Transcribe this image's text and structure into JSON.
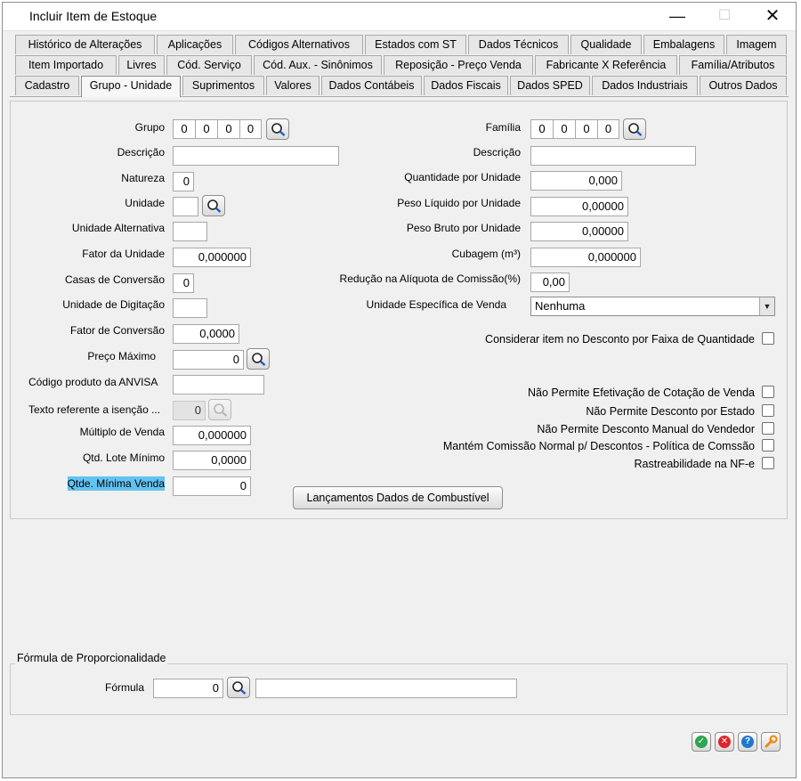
{
  "window": {
    "title": "Incluir Item de Estoque",
    "min_icon": "minimize-icon",
    "max_icon": "maximize-icon",
    "close_icon": "close-icon"
  },
  "tabs": {
    "row1": [
      "Histórico de Alterações",
      "Aplicações",
      "Códigos Alternativos",
      "Estados com ST",
      "Dados Técnicos",
      "Qualidade",
      "Embalagens",
      "Imagem"
    ],
    "row2": [
      "Item Importado",
      "Livres",
      "Cód. Serviço",
      "Cód. Aux. - Sinônimos",
      "Reposição - Preço Venda",
      "Fabricante X Referência",
      "Família/Atributos"
    ],
    "row3": [
      "Cadastro",
      "Grupo - Unidade",
      "Suprimentos",
      "Valores",
      "Dados Contábeis",
      "Dados Fiscais",
      "Dados SPED",
      "Dados Industriais",
      "Outros Dados"
    ],
    "active": "Grupo - Unidade"
  },
  "left": {
    "grupo": {
      "label": "Grupo",
      "segments": [
        "0",
        "0",
        "0",
        "0"
      ]
    },
    "descricao": {
      "label": "Descrição",
      "value": ""
    },
    "natureza": {
      "label": "Natureza",
      "value": "0"
    },
    "unidade": {
      "label": "Unidade",
      "value": ""
    },
    "unidade_alternativa": {
      "label": "Unidade Alternativa",
      "value": ""
    },
    "fator_unidade": {
      "label": "Fator da Unidade",
      "value": "0,000000"
    },
    "casas_conversao": {
      "label": "Casas de Conversão",
      "value": "0"
    },
    "unidade_digitacao": {
      "label": "Unidade de Digitação",
      "value": ""
    },
    "fator_conversao": {
      "label": "Fator de Conversão",
      "value": "0,0000"
    },
    "preco_maximo": {
      "label": "Preço Máximo",
      "value": "0"
    },
    "codigo_anvisa": {
      "label": "Código produto da ANVISA",
      "value": ""
    },
    "texto_isencao": {
      "label": "Texto referente a isenção ...",
      "value": "0"
    },
    "multiplo_venda": {
      "label": "Múltiplo de Venda",
      "value": "0,000000"
    },
    "qtd_lote_minimo": {
      "label": "Qtd. Lote Mínimo",
      "value": "0,0000"
    },
    "qtde_minima_venda": {
      "label": "Qtde. Mínima Venda",
      "value": "0"
    }
  },
  "right": {
    "familia": {
      "label": "Família",
      "segments": [
        "0",
        "0",
        "0",
        "0"
      ]
    },
    "descricao": {
      "label": "Descrição",
      "value": ""
    },
    "quantidade_unidade": {
      "label": "Quantidade por Unidade",
      "value": "0,000"
    },
    "peso_liquido": {
      "label": "Peso Líquido por Unidade",
      "value": "0,00000"
    },
    "peso_bruto": {
      "label": "Peso Bruto por Unidade",
      "value": "0,00000"
    },
    "cubagem": {
      "label": "Cubagem (m³)",
      "value": "0,000000"
    },
    "reducao_comissao": {
      "label": "Redução na Alíquota de Comissão(%)",
      "value": "0,00"
    },
    "unidade_especifica": {
      "label": "Unidade Específica de Venda",
      "value": "Nenhuma"
    },
    "checks": {
      "desconto_faixa": "Considerar item no Desconto por Faixa de Quantidade",
      "efetivacao_cotacao": "Não Permite Efetivação de Cotação de Venda",
      "desconto_estado": "Não Permite Desconto por Estado",
      "desconto_manual": "Não Permite Desconto Manual do Vendedor",
      "comissao_normal": "Mantém Comissão Normal p/ Descontos - Política de Comssão",
      "rastreabilidade": "Rastreabilidade na NF-e"
    }
  },
  "combustivel_button": "Lançamentos Dados de Combustível",
  "formula_group": {
    "title": "Fórmula de Proporcionalidade",
    "label": "Fórmula",
    "code": "0",
    "description": ""
  },
  "actions": {
    "confirm_icon": "check-icon",
    "cancel_icon": "cancel-icon",
    "help_icon": "help-icon",
    "tools_icon": "wrench-icon",
    "help_glyph": "?"
  },
  "colors": {
    "highlight": "#62c3f2",
    "confirm": "#2ea44f",
    "cancel": "#e0242b",
    "help": "#1f77d0",
    "tools": "#f08a14"
  }
}
